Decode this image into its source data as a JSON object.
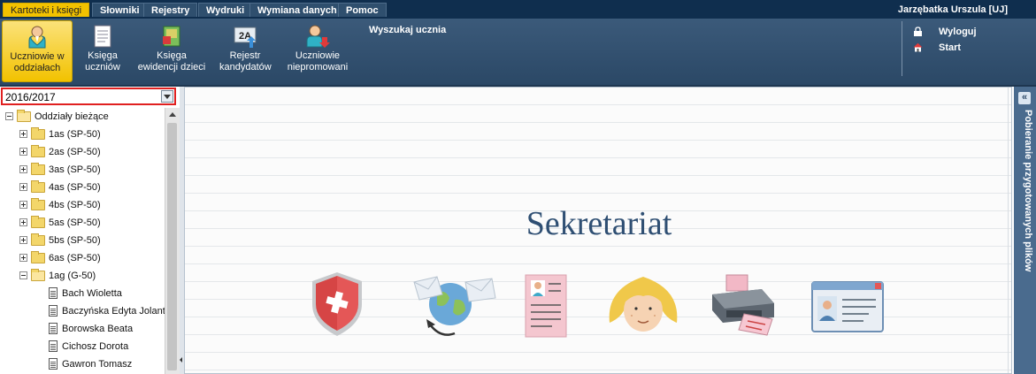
{
  "menu": {
    "tabs": [
      "Kartoteki i księgi",
      "Słowniki",
      "Rejestry",
      "Wydruki",
      "Wymiana danych",
      "Pomoc"
    ],
    "user": "Jarzębatka Urszula [UJ]"
  },
  "ribbon": {
    "buttons": [
      {
        "line1": "Uczniowie w",
        "line2": "oddziałach"
      },
      {
        "line1": "Księga",
        "line2": "uczniów"
      },
      {
        "line1": "Księga",
        "line2": "ewidencji dzieci"
      },
      {
        "line1": "Rejestr",
        "line2": "kandydatów"
      },
      {
        "line1": "Uczniowie",
        "line2": "niepromowani"
      }
    ],
    "search_label": "Wyszukaj ucznia",
    "logout_label": "Wyloguj",
    "start_label": "Start"
  },
  "year_select": {
    "value": "2016/2017"
  },
  "tree": {
    "root": "Oddziały bieżące",
    "classes": [
      "1as (SP-50)",
      "2as (SP-50)",
      "3as (SP-50)",
      "4as (SP-50)",
      "4bs (SP-50)",
      "5as (SP-50)",
      "5bs (SP-50)",
      "6as (SP-50)",
      "1ag (G-50)"
    ],
    "students": [
      "Bach Wioletta",
      "Baczyńska Edyta Jolanta",
      "Borowska Beata",
      "Cichosz Dorota",
      "Gawron Tomasz"
    ]
  },
  "main": {
    "title": "Sekretariat"
  },
  "right_panel": {
    "label": "Pobieranie przygotowanych plików"
  },
  "icons": [
    "user-icon",
    "book-icon",
    "map-book-icon",
    "register-2a-icon",
    "user-down-icon",
    "lock-icon",
    "home-icon",
    "shield-icon",
    "globe-mail-icon",
    "certificate-icon",
    "girl-face-icon",
    "printer-icon",
    "id-card-icon"
  ],
  "colors": {
    "active_tab": "#f2c200",
    "ribbon": "#2b4866",
    "title": "#2f4f73",
    "highlight": "#e02020"
  }
}
